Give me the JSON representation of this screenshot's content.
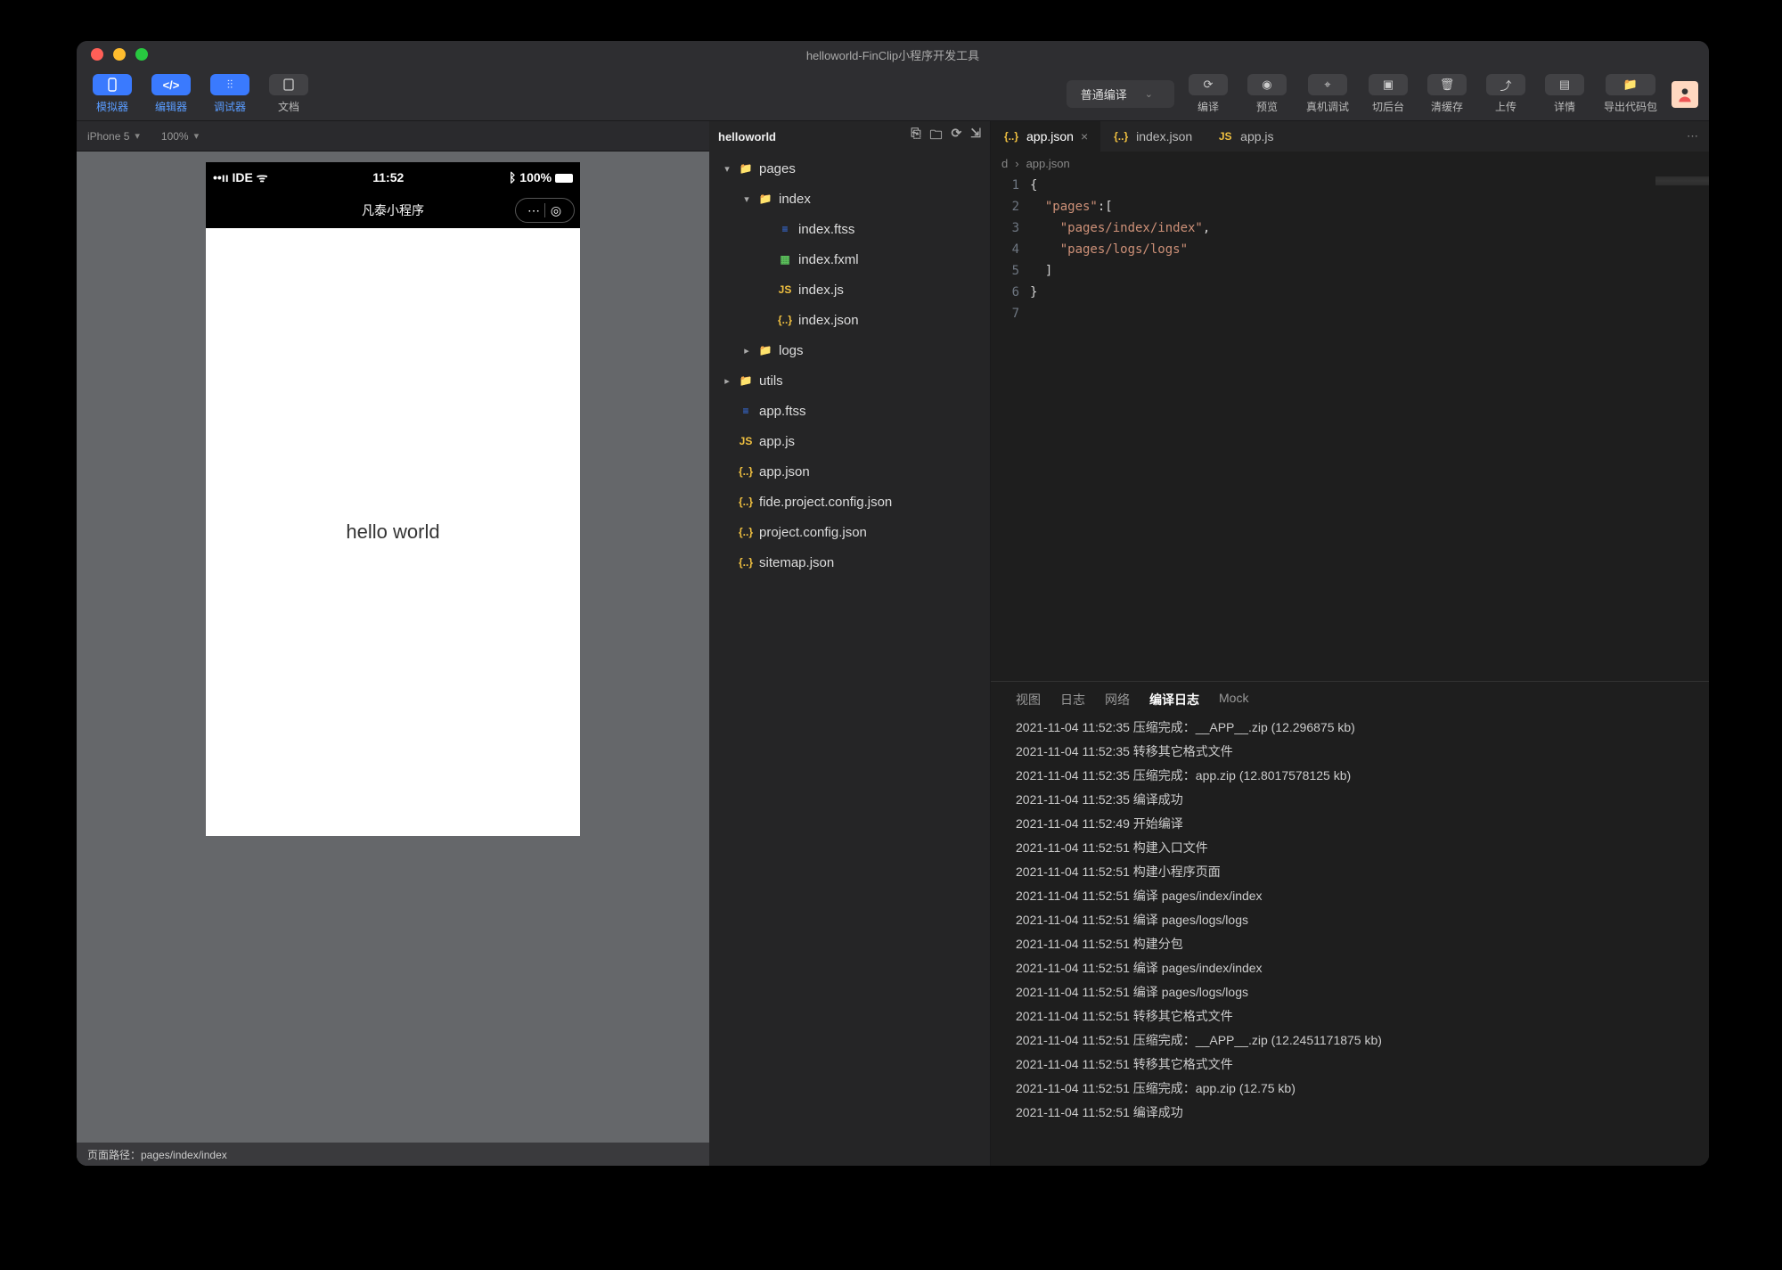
{
  "window": {
    "title": "helloworld-FinClip小程序开发工具"
  },
  "toolbar": {
    "simulator": "模拟器",
    "editor": "编辑器",
    "debugger": "调试器",
    "docs": "文档",
    "compile_select": "普通编译",
    "compile": "编译",
    "preview": "预览",
    "remote": "真机调试",
    "background": "切后台",
    "cache": "清缓存",
    "upload": "上传",
    "details": "详情",
    "export": "导出代码包"
  },
  "simbar": {
    "device": "iPhone 5",
    "zoom": "100%"
  },
  "phone": {
    "signal": "IDE",
    "time": "11:52",
    "battery": "100%",
    "nav_title": "凡泰小程序",
    "content": "hello world"
  },
  "status": {
    "path": "页面路径：pages/index/index"
  },
  "explorer": {
    "project": "helloworld",
    "tree": [
      {
        "depth": 0,
        "type": "folder",
        "name": "pages",
        "open": true
      },
      {
        "depth": 1,
        "type": "folder",
        "name": "index",
        "open": true
      },
      {
        "depth": 2,
        "type": "css",
        "name": "index.ftss"
      },
      {
        "depth": 2,
        "type": "fxml",
        "name": "index.fxml"
      },
      {
        "depth": 2,
        "type": "js",
        "name": "index.js"
      },
      {
        "depth": 2,
        "type": "json",
        "name": "index.json"
      },
      {
        "depth": 1,
        "type": "folder",
        "name": "logs",
        "open": false
      },
      {
        "depth": 0,
        "type": "folder",
        "name": "utils",
        "open": false
      },
      {
        "depth": 0,
        "type": "css",
        "name": "app.ftss"
      },
      {
        "depth": 0,
        "type": "js",
        "name": "app.js"
      },
      {
        "depth": 0,
        "type": "json",
        "name": "app.json"
      },
      {
        "depth": 0,
        "type": "json",
        "name": "fide.project.config.json"
      },
      {
        "depth": 0,
        "type": "json",
        "name": "project.config.json"
      },
      {
        "depth": 0,
        "type": "json",
        "name": "sitemap.json"
      }
    ]
  },
  "editor": {
    "tabs": [
      {
        "icon": "json",
        "name": "app.json",
        "active": true,
        "close": true
      },
      {
        "icon": "json",
        "name": "index.json",
        "active": false,
        "close": false
      },
      {
        "icon": "js",
        "name": "app.js",
        "active": false,
        "close": false
      }
    ],
    "breadcrumb": [
      "d",
      "app.json"
    ],
    "code_lines": [
      "{",
      "  \"pages\":[",
      "    \"pages/index/index\",",
      "    \"pages/logs/logs\"",
      "  ]",
      "}",
      ""
    ]
  },
  "console": {
    "tabs": [
      "视图",
      "日志",
      "网络",
      "编译日志",
      "Mock"
    ],
    "active_tab": 3,
    "logs": [
      "2021-11-04 11:52:35 压缩完成：__APP__.zip (12.296875 kb)",
      "2021-11-04 11:52:35 转移其它格式文件",
      "2021-11-04 11:52:35 压缩完成：app.zip (12.8017578125 kb)",
      "2021-11-04 11:52:35 编译成功",
      "2021-11-04 11:52:49 开始编译",
      "2021-11-04 11:52:51 构建入口文件",
      "2021-11-04 11:52:51 构建小程序页面",
      "2021-11-04 11:52:51 编译 pages/index/index",
      "2021-11-04 11:52:51 编译 pages/logs/logs",
      "2021-11-04 11:52:51 构建分包",
      "2021-11-04 11:52:51 编译 pages/index/index",
      "2021-11-04 11:52:51 编译 pages/logs/logs",
      "2021-11-04 11:52:51 转移其它格式文件",
      "2021-11-04 11:52:51 压缩完成：__APP__.zip (12.2451171875 kb)",
      "2021-11-04 11:52:51 转移其它格式文件",
      "2021-11-04 11:52:51 压缩完成：app.zip (12.75 kb)",
      "2021-11-04 11:52:51 编译成功"
    ]
  }
}
